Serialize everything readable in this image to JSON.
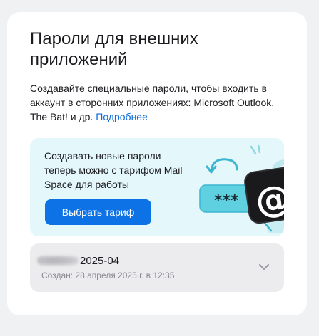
{
  "card": {
    "title": "Пароли для внешних приложений",
    "description": "Создавайте специальные пароли, чтобы входить в аккаунт в сторонних приложениях: Microsoft Outlook, The Bat! и др.",
    "more_link": "Подробнее"
  },
  "promo": {
    "text": "Создавать новые пароли теперь можно с тарифом Mail Space для работы",
    "button_label": "Выбрать тариф",
    "password_mask": "***",
    "at_symbol": "@"
  },
  "passwords": [
    {
      "name": "2025-04",
      "created": "Создан: 28 апреля 2025 г. в 12:35"
    }
  ],
  "colors": {
    "accent": "#0d72e6",
    "link": "#0d6bd9",
    "promo_bg": "#e4f8fb",
    "item_bg": "#ececee"
  },
  "icons": {
    "expand": "chevron-down-icon",
    "illustration": "password-at-illustration"
  }
}
